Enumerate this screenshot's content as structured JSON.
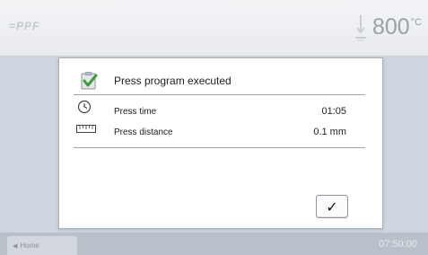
{
  "header": {
    "logo_text": "=PPF",
    "press_icon": "press-arrow-icon",
    "temperature_value": "800",
    "temperature_unit": "°C"
  },
  "dialog": {
    "title_icon": "clipboard-check-icon",
    "title": "Press program executed",
    "rows": [
      {
        "icon": "clock-icon",
        "label": "Press time",
        "value": "01:05"
      },
      {
        "icon": "ruler-icon",
        "label": "Press distance",
        "value": "0.1 mm"
      }
    ],
    "confirm_icon": "checkmark-icon",
    "confirm_symbol": "✓"
  },
  "footer": {
    "home_arrow": "◀",
    "home_label": "Home",
    "clock": "07:50:00"
  },
  "colors": {
    "content_background": "#cdd5de",
    "footer_background": "#b9c0c9",
    "checkbox_green": "#3c9a3c"
  }
}
